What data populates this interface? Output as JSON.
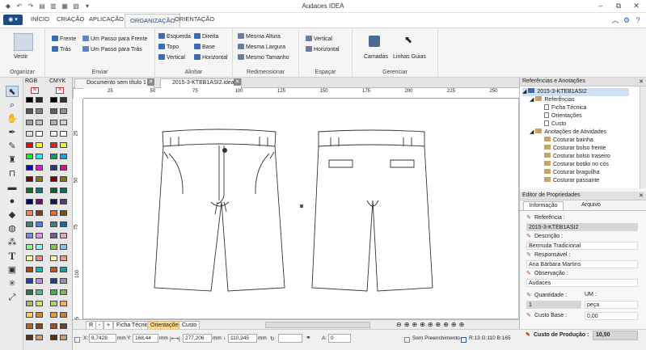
{
  "window": {
    "title": "Audaces IDEA"
  },
  "quick_access": [
    "undo-icon",
    "redo-icon",
    "new-icon",
    "open-icon",
    "save-icon",
    "print-icon"
  ],
  "ribbon_tabs": [
    {
      "label": "INÍCIO",
      "active": false
    },
    {
      "label": "CRIAÇÃO",
      "active": false
    },
    {
      "label": "APLICAÇÃO",
      "active": false
    },
    {
      "label": "ORGANIZAÇÃO",
      "active": true
    },
    {
      "label": "ORIENTAÇÃO",
      "active": false
    }
  ],
  "ribbon": {
    "organizar": {
      "label": "Organizar",
      "vestir": "Vestir"
    },
    "enviar": {
      "label": "Enviar",
      "frente": "Frente",
      "tras": "Trás",
      "um_passo_frente": "Um Passo para Frente",
      "um_passo_tras": "Um Passo para Trás"
    },
    "alinhar": {
      "label": "Alinhar",
      "esquerda": "Esquerda",
      "topo": "Topo",
      "vertical": "Vertical",
      "direita": "Direita",
      "base": "Base",
      "horizontal": "Horizontal"
    },
    "redimensionar": {
      "label": "Redimensionar",
      "mesma_altura": "Mesma Altura",
      "mesma_largura": "Mesma Largura",
      "mesmo_tamanho": "Mesmo Tamanho"
    },
    "espacar": {
      "label": "Espaçar",
      "vertical": "Vertical",
      "horizontal": "Horizontal"
    },
    "gerenciar": {
      "label": "Gerenciar",
      "camadas": "Camadas",
      "linhas_guias": "Linhas Guias"
    }
  },
  "palettes": {
    "rgb": "RGB",
    "cmyk": "CMYK"
  },
  "doc_tabs": [
    {
      "label": "Documento sem título 1 *",
      "active": false
    },
    {
      "label": "2015-3-KTEB1ASI2.idea *",
      "active": true
    }
  ],
  "ruler": {
    "h": [
      "25",
      "50",
      "75",
      "100",
      "125",
      "150",
      "175",
      "200",
      "225",
      "250"
    ],
    "v": [
      "25",
      "50",
      "75",
      "100",
      "125"
    ]
  },
  "page_tabs": {
    "r": "R",
    "minus": "-",
    "plus": "+",
    "tabs": [
      {
        "label": "Ficha Técnica",
        "active": false
      },
      {
        "label": "Orientações",
        "active": true
      },
      {
        "label": "Custo",
        "active": false
      }
    ]
  },
  "status": {
    "x_label": "X:",
    "x": "8,7428",
    "y_label": "Y:",
    "y": "168,44",
    "w": "277,206",
    "h": "110,345",
    "unit": "mm",
    "a_label": "A:",
    "a": "0",
    "fill": "Sem Preenchimento",
    "rgb": "R:13  G:110  B:165"
  },
  "references": {
    "title": "Referências e Anotações",
    "root": "2015-3-KTEB1ASI2",
    "refs_folder": "Referências",
    "refs": [
      "Ficha Técnica",
      "Orientações",
      "Custo"
    ],
    "notes_folder": "Anotações de Atividades",
    "notes": [
      "Costurar bainha",
      "Costurar bolso frente",
      "Costurar bolso traseiro",
      "Costurar botão no cós",
      "Costurar braguilha",
      "Costurar passante"
    ]
  },
  "properties": {
    "title": "Editor de Propriedades",
    "tabs": [
      "Informação",
      "Arquivo"
    ],
    "ref_label": "Referência :",
    "ref_value": "2015-3-KTEB1ASI2",
    "desc_label": "Descrição :",
    "desc_value": "Bermuda Tradicional",
    "resp_label": "Responsável :",
    "resp_value": "Ana Bárbara Martins",
    "obs_label": "Observação :",
    "obs_value": "Audaces",
    "qty_label": "Quantidade :",
    "qty_value": "1",
    "um_label": "UM :",
    "um_value": "peça",
    "base_label": "Custo Base :",
    "base_value": "0,00",
    "prod_label": "Custo de Produção :",
    "prod_value": "10,50"
  }
}
